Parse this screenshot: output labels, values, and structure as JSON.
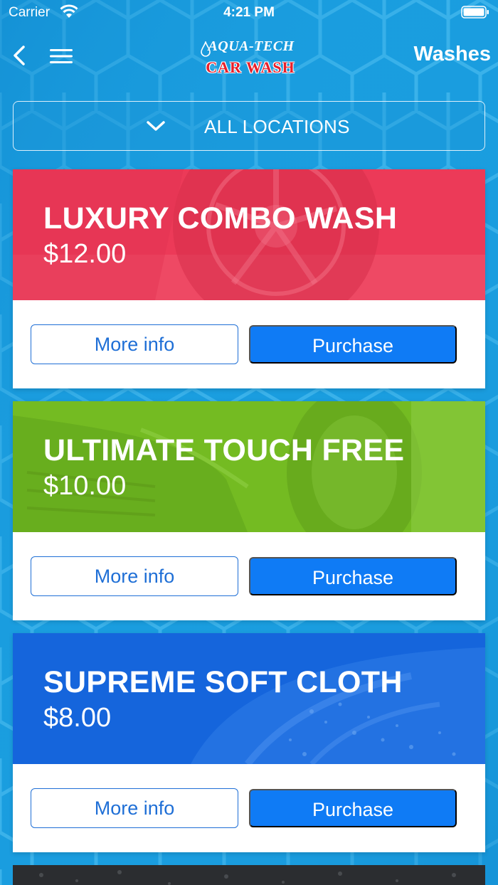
{
  "status_bar": {
    "carrier": "Carrier",
    "time": "4:21 PM"
  },
  "nav": {
    "back_icon": "chevron-left-icon",
    "menu_icon": "hamburger-menu-icon",
    "logo_top": "AQUA-TECH",
    "logo_bottom": "CAR WASH",
    "title": "Washes"
  },
  "location_selector": {
    "label": "ALL LOCATIONS",
    "icon": "chevron-down-icon"
  },
  "washes": [
    {
      "title": "LUXURY COMBO WASH",
      "price": "$12.00",
      "color": "#ec3a58",
      "more_info_label": "More info",
      "purchase_label": "Purchase"
    },
    {
      "title": "ULTIMATE TOUCH FREE",
      "price": "$10.00",
      "color": "#74bb22",
      "more_info_label": "More info",
      "purchase_label": "Purchase"
    },
    {
      "title": "SUPREME SOFT CLOTH",
      "price": "$8.00",
      "color": "#1565dc",
      "more_info_label": "More info",
      "purchase_label": "Purchase"
    }
  ],
  "colors": {
    "background": "#169bdd",
    "button_primary": "#0f7bf5",
    "button_outline": "#1f6fd6",
    "logo_red": "#e8202a"
  }
}
